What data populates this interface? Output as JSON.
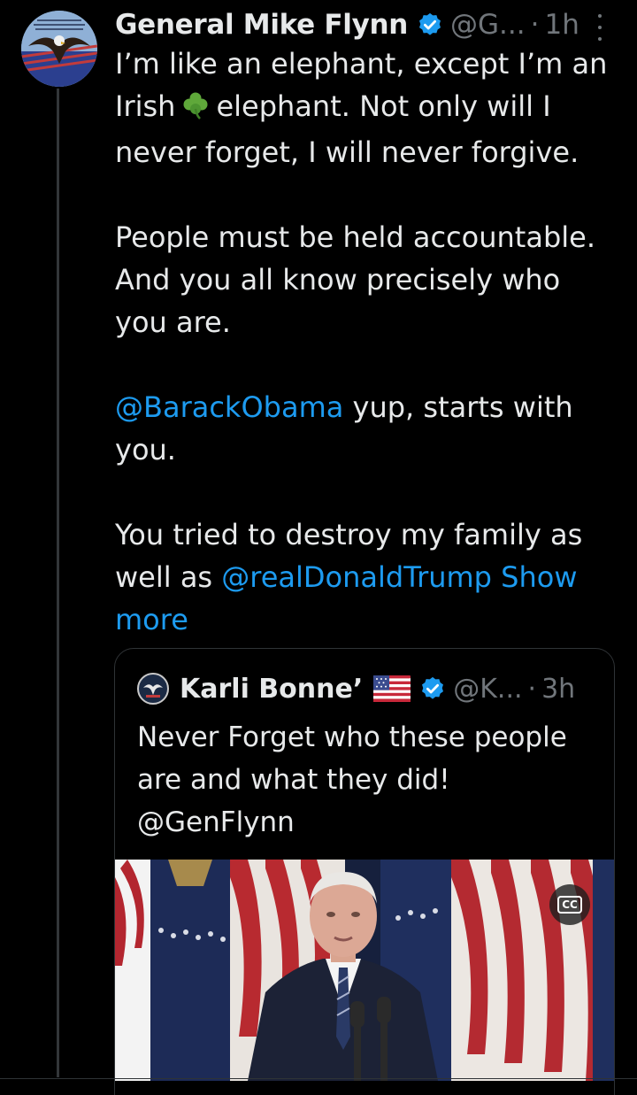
{
  "tweet": {
    "author_name": "General Mike Flynn",
    "handle": "@G...",
    "separator": "·",
    "time": "1h",
    "paragraphs": {
      "p1_a": "I’m like an elephant, except I’m an Irish",
      "p1_b": "elephant. Not only will I never forget, I will never forgive.",
      "p2": "People must be held accountable. And you all know precisely who you are.",
      "p3_mention": "@BarackObama",
      "p3_rest": " yup, starts with you.",
      "p4_a": "You tried to destroy my family as well as ",
      "p4_mention": "@realDonaldTrump",
      "p4_show_more": "Show more"
    },
    "icons": {
      "verified": "verified-badge-icon",
      "shamrock": "shamrock-emoji",
      "more": "more-options-icon"
    }
  },
  "quote": {
    "author_name": "Karli Bonne’",
    "handle": "@K...",
    "separator": "·",
    "time": "3h",
    "text": "Never Forget who these people are and what they did!",
    "mention": "@GenFlynn",
    "media_caption_label": "CC"
  },
  "colors": {
    "background": "#000000",
    "text": "#e7e9ea",
    "secondary": "#71767b",
    "link": "#1d9bf0",
    "border": "#2f3336"
  }
}
